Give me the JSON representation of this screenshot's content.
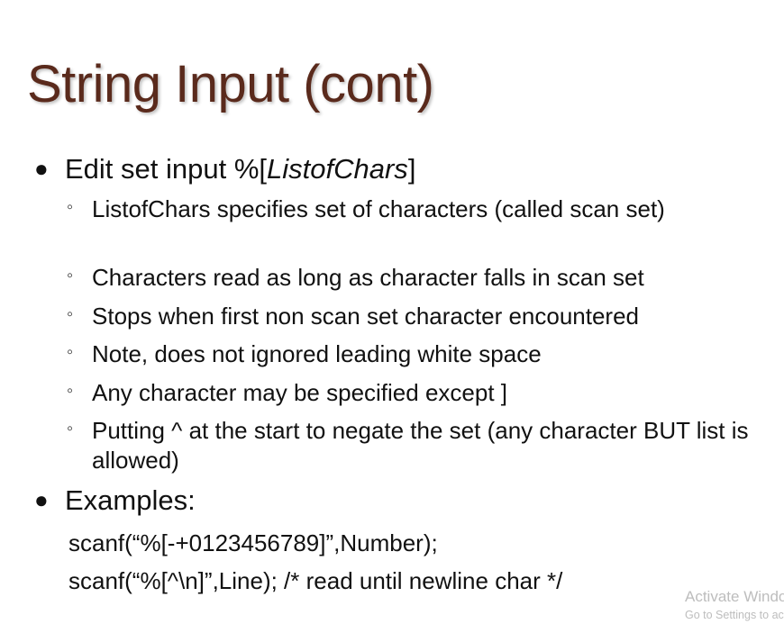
{
  "slide": {
    "title": "String Input (cont)"
  },
  "bullets": {
    "edit_set": {
      "prefix": "Edit set input %[",
      "italic": "ListofChars",
      "suffix": "]"
    },
    "sub_items": [
      "ListofChars specifies set of characters (called scan set)",
      "Characters read as long as character falls in scan set",
      "Stops when first non scan set character encountered",
      "Note, does not ignored leading white space",
      "Any character may be specified except ]",
      "Putting ^ at the start to negate the set (any character BUT list is allowed)"
    ],
    "examples_label": "Examples:",
    "code_lines": [
      "scanf(“%[-+0123456789]”,Number);",
      "scanf(“%[^\\n]”,Line); /* read until newline char */"
    ]
  },
  "watermark": {
    "title": "Activate Windows",
    "subtitle": "Go to Settings to activate Windows."
  },
  "colors": {
    "title": "#5a2a1c",
    "text": "#111111",
    "watermark": "#bdbdbd"
  }
}
